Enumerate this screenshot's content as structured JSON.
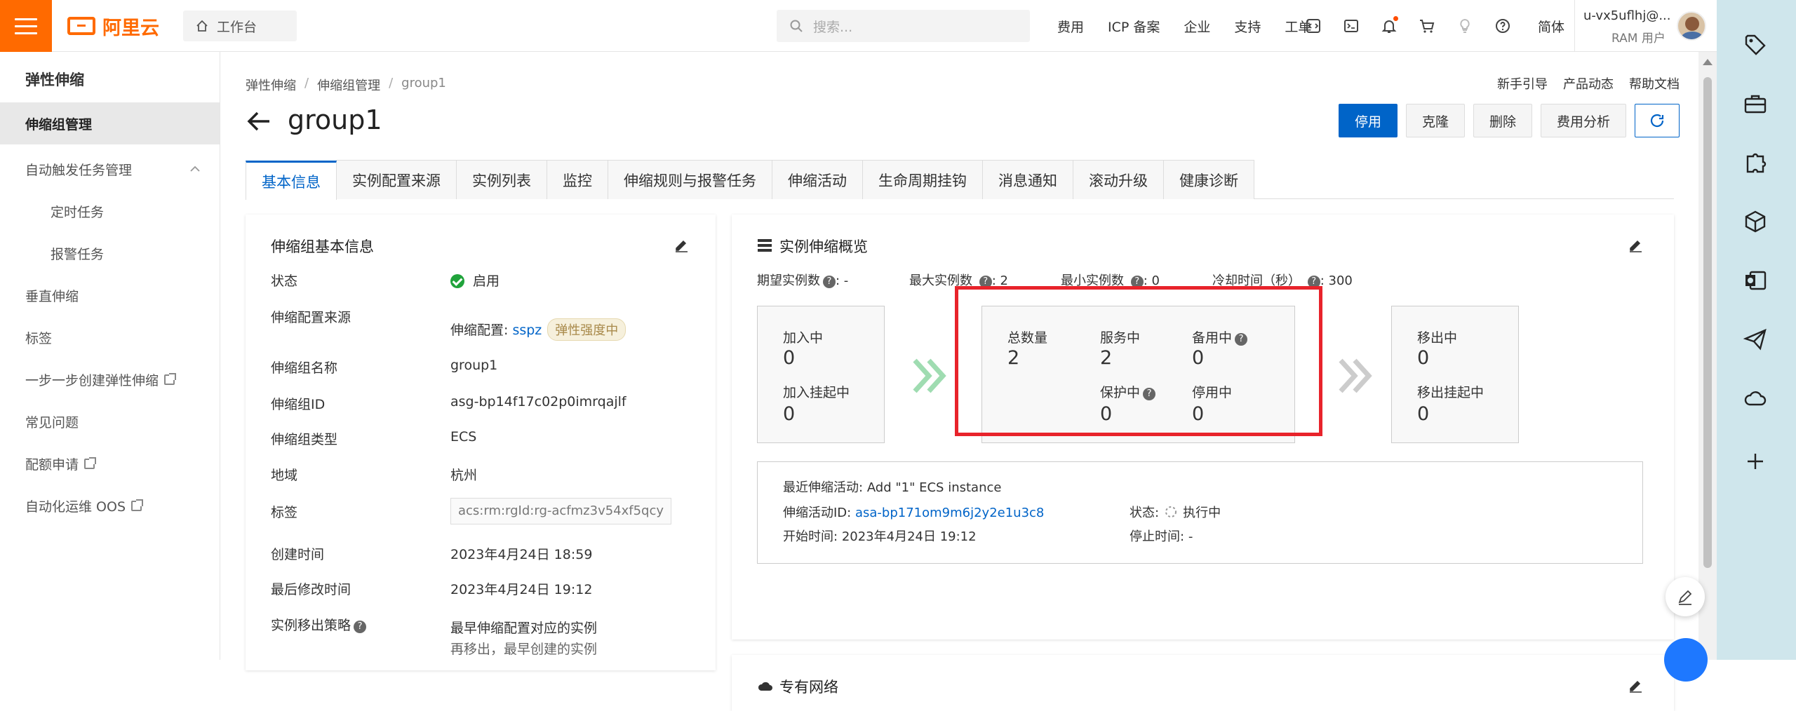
{
  "topbar": {
    "logo_text": "阿里云",
    "workbench": "工作台",
    "search_placeholder": "搜索...",
    "nav": [
      "费用",
      "ICP 备案",
      "企业",
      "支持",
      "工单"
    ],
    "lang": "简体",
    "username": "u-vx5uflhj@...",
    "user_role": "RAM 用户",
    "icons": [
      "code-icon",
      "terminal-icon",
      "bell-icon",
      "cart-icon",
      "lightbulb-icon",
      "help-icon"
    ]
  },
  "sidebar": {
    "title": "弹性伸缩",
    "items": [
      {
        "label": "伸缩组管理",
        "active": true
      },
      {
        "label": "自动触发任务管理",
        "expanded": true
      },
      {
        "label": "定时任务",
        "sub": true
      },
      {
        "label": "报警任务",
        "sub": true
      },
      {
        "label": "垂直伸缩"
      },
      {
        "label": "标签"
      },
      {
        "label": "一步一步创建弹性伸缩",
        "external": true
      },
      {
        "label": "常见问题"
      },
      {
        "label": "配额申请",
        "external": true
      },
      {
        "label": "自动化运维 OOS",
        "external": true
      }
    ]
  },
  "main": {
    "breadcrumb": [
      "弹性伸缩",
      "伸缩组管理",
      "group1"
    ],
    "help_links": [
      "新手引导",
      "产品动态",
      "帮助文档"
    ],
    "title": "group1",
    "actions": {
      "disable": "停用",
      "clone": "克隆",
      "delete": "删除",
      "cost": "费用分析"
    },
    "tabs": [
      "基本信息",
      "实例配置来源",
      "实例列表",
      "监控",
      "伸缩规则与报警任务",
      "伸缩活动",
      "生命周期挂钩",
      "消息通知",
      "滚动升级",
      "健康诊断"
    ],
    "active_tab": "基本信息"
  },
  "basic_info": {
    "title": "伸缩组基本信息",
    "rows": {
      "status_label": "状态",
      "status_value": "启用",
      "config_label": "伸缩配置来源",
      "config_prefix": "伸缩配置:",
      "config_link": "sspz",
      "config_tag": "弹性强度中",
      "name_label": "伸缩组名称",
      "name_value": "group1",
      "id_label": "伸缩组ID",
      "id_value": "asg-bp14f17c02p0imrqajlf",
      "type_label": "伸缩组类型",
      "type_value": "ECS",
      "region_label": "地域",
      "region_value": "杭州",
      "tag_label": "标签",
      "tag_value": "acs:rm:rgId:rg-acfmz3v54xf5qcy",
      "created_label": "创建时间",
      "created_value": "2023年4月24日 18:59",
      "modified_label": "最后修改时间",
      "modified_value": "2023年4月24日 19:12",
      "removal_label": "实例移出策略",
      "removal_value": "最早伸缩配置对应的实例",
      "removal_value2": "再移出，最早创建的实例"
    }
  },
  "overview": {
    "title": "实例伸缩概览",
    "desired_label": "期望实例数",
    "desired_value": "-",
    "max_label": "最大实例数",
    "max_value": "2",
    "min_label": "最小实例数",
    "min_value": "0",
    "cooldown_label": "冷却时间（秒）",
    "cooldown_value": "300",
    "joining_label": "加入中",
    "joining_value": "0",
    "join_hook_label": "加入挂起中",
    "join_hook_value": "0",
    "total_label": "总数量",
    "total_value": "2",
    "in_service_label": "服务中",
    "in_service_value": "2",
    "standby_label": "备用中",
    "standby_value": "0",
    "protected_label": "保护中",
    "protected_value": "0",
    "stopped_label": "停用中",
    "stopped_value": "0",
    "removing_label": "移出中",
    "removing_value": "0",
    "remove_hook_label": "移出挂起中",
    "remove_hook_value": "0",
    "activity_recent_label": "最近伸缩活动:",
    "activity_recent_value": "Add \"1\" ECS instance",
    "activity_id_label": "伸缩活动ID:",
    "activity_id_value": "asa-bp171om9m6j2y2e1u3c8",
    "activity_status_label": "状态:",
    "activity_status_value": "执行中",
    "activity_start_label": "开始时间:",
    "activity_start_value": "2023年4月24日 19:12",
    "activity_stop_label": "停止时间:",
    "activity_stop_value": "-"
  },
  "vpc": {
    "title": "专有网络"
  },
  "colors": {
    "brand": "#ff6a00",
    "primary": "#0064c8",
    "highlight": "#e8232b",
    "success": "#20a33b",
    "rail": "#cfe6ec"
  }
}
